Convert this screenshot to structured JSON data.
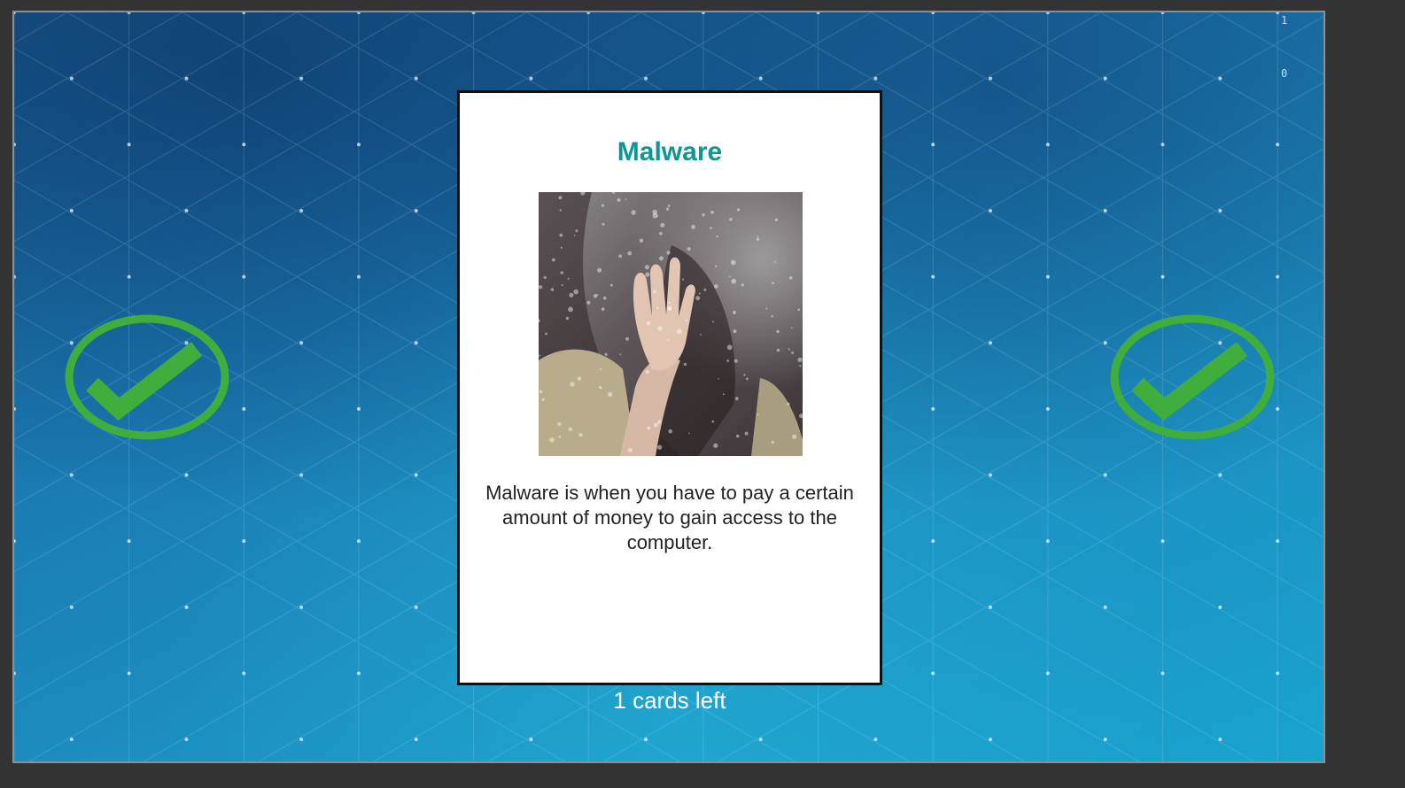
{
  "card": {
    "title": "Malware",
    "description": "Malware is when you have to pay a certain amount of money to gain access to the computer.",
    "image_subject": "hand pressed against rainy window"
  },
  "status": {
    "cards_left": "1 cards left"
  },
  "corner_digits": [
    "1",
    "0"
  ],
  "icons": {
    "left_choice": "checkmark-circle-icon",
    "right_choice": "checkmark-circle-icon"
  },
  "colors": {
    "title": "#0e9595",
    "check": "#3fae3c",
    "background": "#1a78b0",
    "frame": "#333333"
  }
}
